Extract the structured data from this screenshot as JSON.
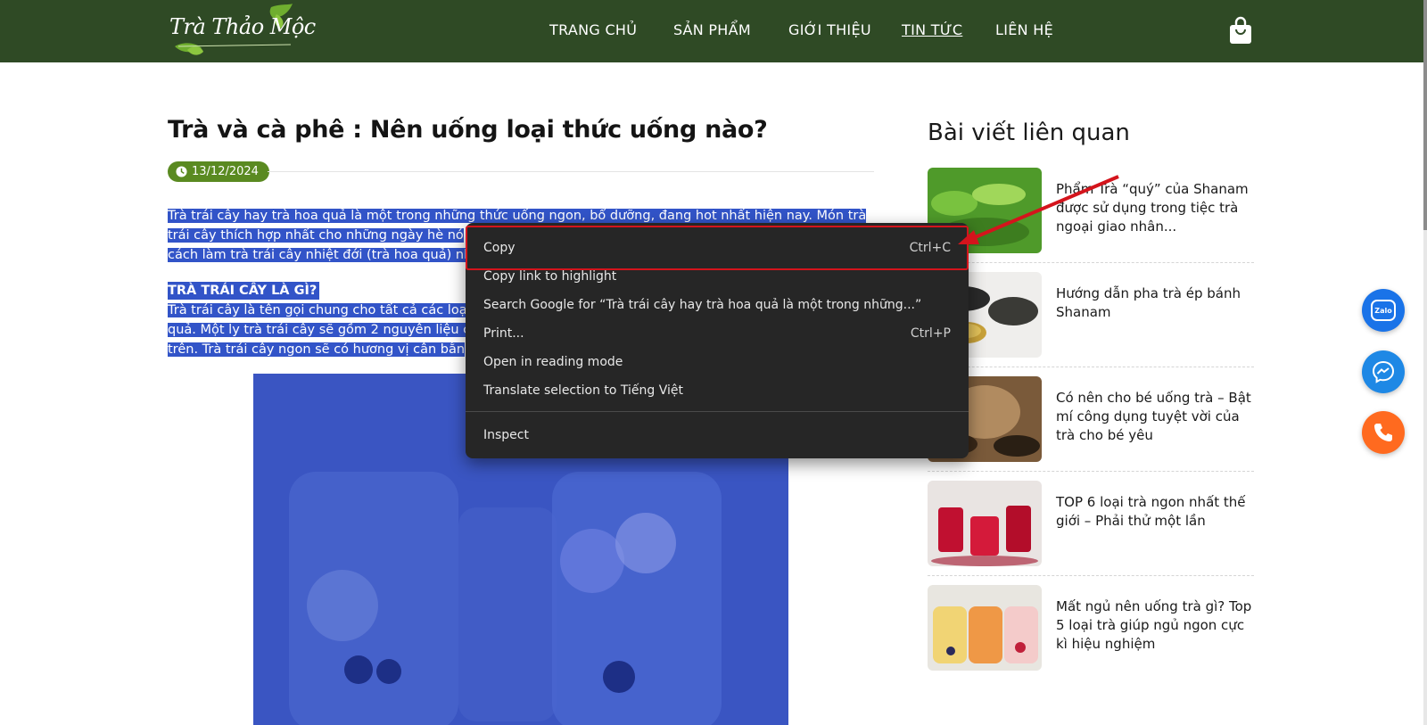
{
  "header": {
    "logo_text": "Trà Thảo Mộc",
    "nav": [
      {
        "label": "TRANG CHỦ",
        "active": false
      },
      {
        "label": "SẢN PHẨM",
        "active": false
      },
      {
        "label": "GIỚI THIỆU",
        "active": false
      },
      {
        "label": "TIN TỨC",
        "active": true
      },
      {
        "label": "LIÊN HỆ",
        "active": false
      }
    ],
    "cart_icon": "shopping-bag-icon"
  },
  "article": {
    "title": "Trà và cà phê : Nên uống loại thức uống nào?",
    "date": "13/12/2024",
    "para1_lines": [
      "Trà trái cây hay trà hoa quả là một trong những thức uống ngon, bổ dưỡng, đang hot nhất hiện nay. Món trà",
      "trái cây thích hợp nhất cho những ngày hè nó",
      "cách làm trà trái cây nhiệt đới (trà hoa quả) nh"
    ],
    "heading2": "TRÀ TRÁI CÂY LÀ GÌ?",
    "para2_lines": [
      "Trà trái cây là tên gọi chung cho tất cả các loạ",
      "quả. Một ly trà trái cây sẽ gồm 2 nguyên liệu c",
      "trên. Trà trái cây ngon sẽ có hương vị cân bằn"
    ]
  },
  "sidebar": {
    "title": "Bài viết liên quan",
    "items": [
      {
        "title": "Phẩm Trà “quý” của Shanam được sử dụng trong tiệc trà ngoại giao nhân..."
      },
      {
        "title": "Hướng dẫn pha trà ép bánh Shanam"
      },
      {
        "title": "Có nên cho bé uống trà – Bật mí công dụng tuyệt vời của trà cho bé yêu"
      },
      {
        "title": "TOP 6 loại trà ngon nhất thế giới – Phải thử một lần"
      },
      {
        "title": "Mất ngủ nên uống trà gì? Top 5 loại trà giúp ngủ ngon cực kì hiệu nghiệm"
      }
    ]
  },
  "floating": {
    "zalo_label": "Zalo",
    "icons": [
      "zalo-icon",
      "messenger-icon",
      "phone-icon"
    ],
    "colors": {
      "zalo": "#1a73e8",
      "messenger": "#1e88e5",
      "phone": "#ff6a1f"
    }
  },
  "context_menu": {
    "items": [
      {
        "label": "Copy",
        "shortcut": "Ctrl+C"
      },
      {
        "label": "Copy link to highlight",
        "shortcut": ""
      },
      {
        "label": "Search Google for “Trà trái cây hay trà hoa quả là một trong những...”",
        "shortcut": ""
      },
      {
        "label": "Print...",
        "shortcut": "Ctrl+P"
      },
      {
        "label": "Open in reading mode",
        "shortcut": ""
      },
      {
        "label": "Translate selection to Tiếng Việt",
        "shortcut": ""
      },
      {
        "label": "Inspect",
        "shortcut": ""
      }
    ]
  },
  "colors": {
    "header_bg": "#2f4a25",
    "date_badge": "#5a8a21",
    "selection": "#3254c8",
    "highlight_box": "#d4141c"
  }
}
